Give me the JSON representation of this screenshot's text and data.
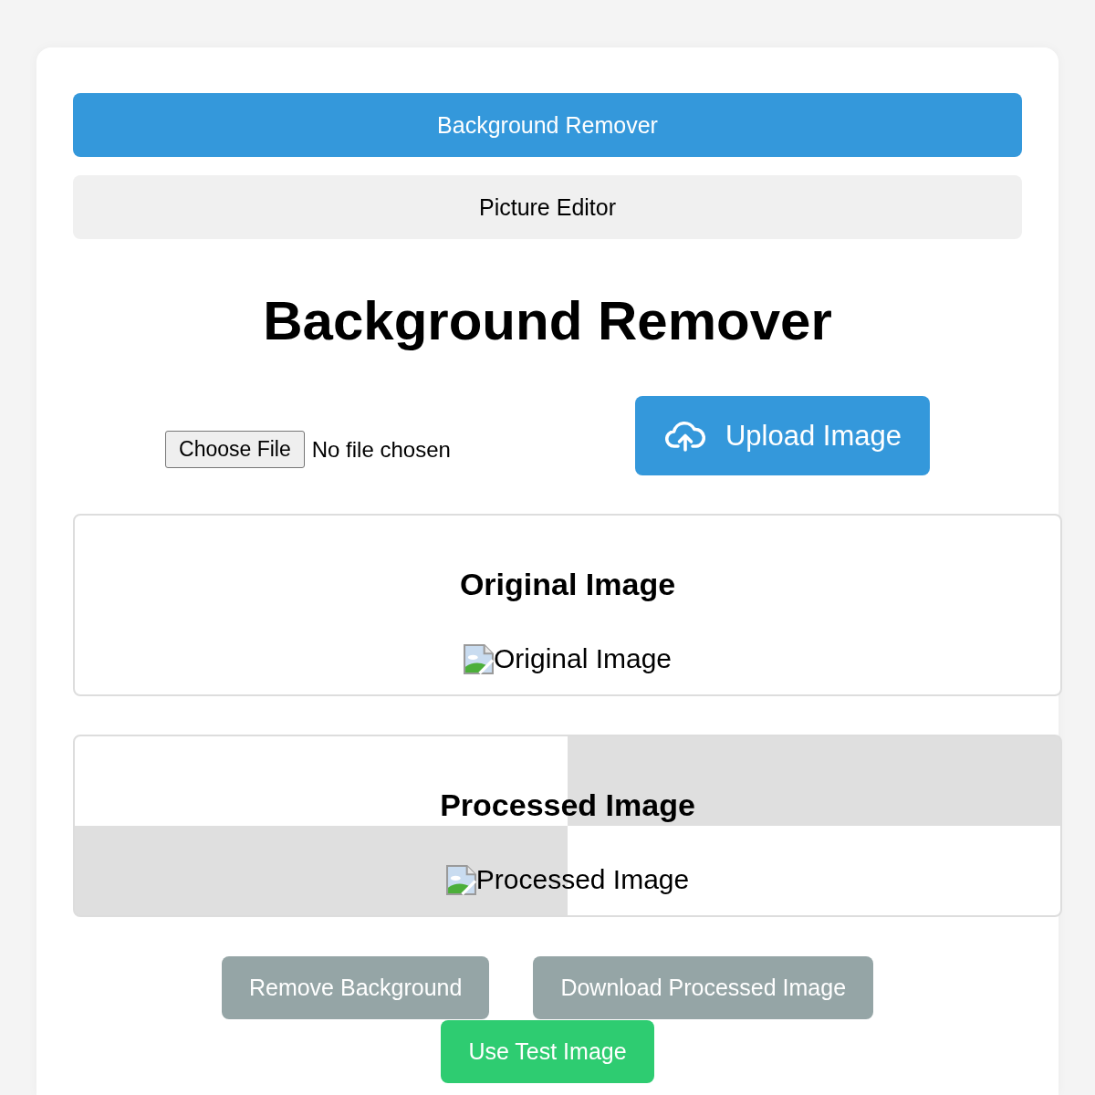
{
  "tabs": [
    {
      "label": "Background Remover",
      "selected": true
    },
    {
      "label": "Picture Editor",
      "selected": false
    }
  ],
  "title": "Background Remover",
  "file_input": {
    "button": "Choose File",
    "status": "No file chosen"
  },
  "upload_button": "Upload Image",
  "panels": [
    {
      "kind": "plain",
      "heading": "Original Image",
      "alt": "Original Image"
    },
    {
      "kind": "checkerboard",
      "heading": "Processed Image",
      "alt": "Processed Image"
    }
  ],
  "actions": [
    {
      "label": "Remove Background",
      "disabled": true
    },
    {
      "label": "Download Processed Image",
      "disabled": true
    },
    {
      "label": "Use Test Image",
      "disabled": false
    }
  ]
}
